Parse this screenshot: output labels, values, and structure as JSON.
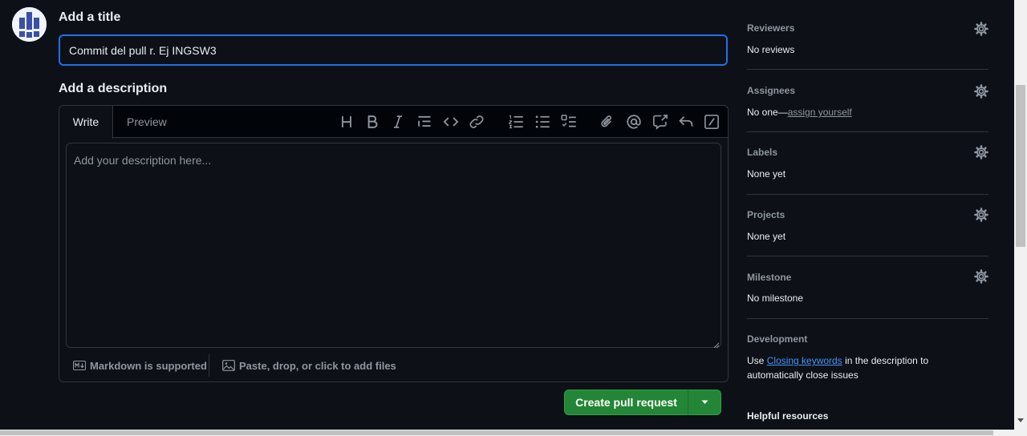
{
  "avatar": {
    "icon": "user-avatar-icon"
  },
  "title_section": {
    "heading": "Add a title",
    "input_value": "Commit del pull r. Ej INGSW3"
  },
  "description_section": {
    "heading": "Add a description",
    "tabs": {
      "write": "Write",
      "preview": "Preview"
    },
    "toolbar": [
      "heading-icon",
      "bold-icon",
      "italic-icon",
      "quote-icon",
      "code-icon",
      "link-icon",
      "numbered-list-icon",
      "unordered-list-icon",
      "task-list-icon",
      "attach-icon",
      "mention-icon",
      "cross-reference-icon",
      "saved-reply-icon",
      "slash-commands-icon"
    ],
    "placeholder": "Add your description here...",
    "footer_markdown": "Markdown is supported",
    "footer_files": "Paste, drop, or click to add files"
  },
  "actions": {
    "create_label": "Create pull request"
  },
  "sidebar": {
    "reviewers": {
      "heading": "Reviewers",
      "value": "No reviews"
    },
    "assignees": {
      "heading": "Assignees",
      "value_prefix": "No one—",
      "value_link": "assign yourself"
    },
    "labels": {
      "heading": "Labels",
      "value": "None yet"
    },
    "projects": {
      "heading": "Projects",
      "value": "None yet"
    },
    "milestone": {
      "heading": "Milestone",
      "value": "No milestone"
    },
    "development": {
      "heading": "Development",
      "text_prefix": "Use ",
      "link": "Closing keywords",
      "text_suffix": " in the description to automatically close issues"
    },
    "helpful": {
      "heading": "Helpful resources"
    }
  },
  "colors": {
    "accent": "#1f6feb",
    "primary_button": "#238636",
    "background": "#0d1117",
    "border": "#30363d",
    "link": "#4493f8"
  }
}
